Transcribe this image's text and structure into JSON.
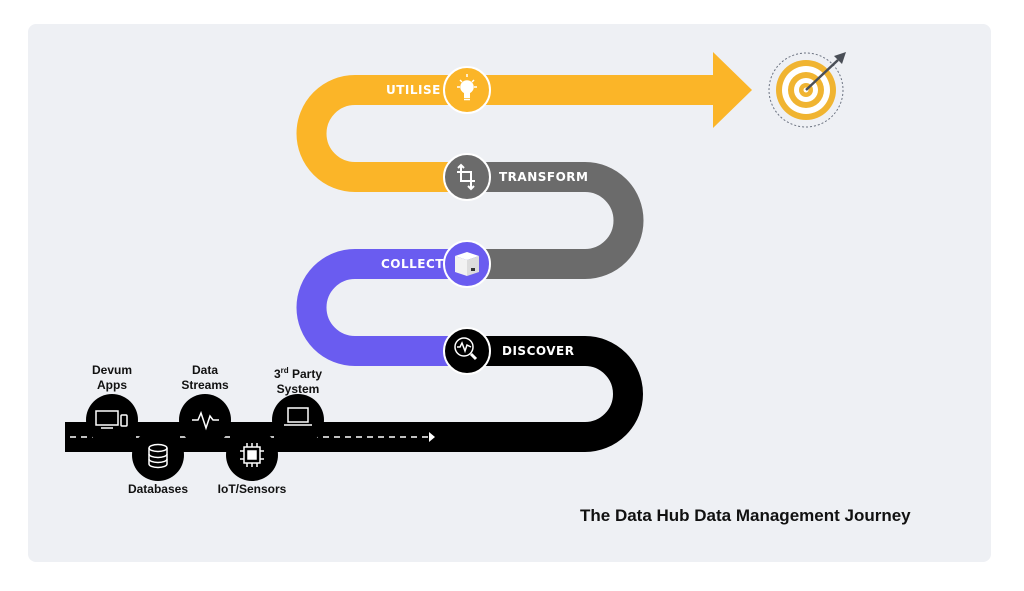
{
  "title": "The Data Hub Data Management Journey",
  "colors": {
    "background": "#eef0f4",
    "utilise": "#fbb528",
    "transform": "#6b6b6b",
    "collect": "#6a5cf0",
    "discover": "#000000",
    "target_ring": "#f0b431",
    "arrow_dark": "#4a4f57"
  },
  "stages": [
    {
      "label": "UTILISE",
      "icon": "lightbulb-icon"
    },
    {
      "label": "TRANSFORM",
      "icon": "crop-transform-icon"
    },
    {
      "label": "COLLECT",
      "icon": "box-icon"
    },
    {
      "label": "DISCOVER",
      "icon": "magnifier-pulse-icon"
    }
  ],
  "goal": {
    "icon": "target-icon"
  },
  "sources_top": [
    {
      "line1": "Devum",
      "line2": "Apps",
      "icon": "monitor-phone-icon"
    },
    {
      "line1": "Data",
      "line2": "Streams",
      "icon": "pulse-icon"
    },
    {
      "line1": "3rd Party",
      "line2": "System",
      "icon": "laptop-icon",
      "sup": "rd",
      "prefix": "3",
      "rest": " Party"
    }
  ],
  "sources_bottom": [
    {
      "label": "Databases",
      "icon": "database-icon"
    },
    {
      "label": "IoT/Sensors",
      "icon": "chip-icon"
    }
  ]
}
